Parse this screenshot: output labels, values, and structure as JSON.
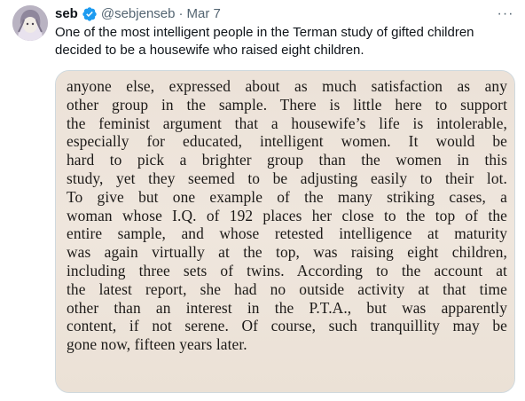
{
  "tweet": {
    "author": {
      "display_name": "seb",
      "handle": "@sebjenseb",
      "separator": "·",
      "date": "Mar 7",
      "verified_icon": "verified-badge-icon",
      "verified_color": "#1d9bf0"
    },
    "more_icon": "more-options-icon",
    "more_glyph": "···",
    "text": "One of the most intelligent people in the Terman study of gifted children decided to be a housewife who raised eight children.",
    "media": {
      "lines": [
        "anyone else, expressed about as much satisfaction as any",
        "other group in the sample. There is little here to support",
        "the feminist argument that a housewife’s life is intolerable,",
        "especially for educated, intelligent women. It would be",
        "hard to pick a brighter group than the women in this",
        "study, yet they seemed to be adjusting easily to their lot.",
        "To give but one example of the many striking cases, a",
        "woman whose I.Q. of 192 places her close to the top of the",
        "entire sample, and whose retested intelligence at maturity",
        "was again virtually at the top, was raising eight children,",
        "including three sets of twins. According to the account at",
        "the latest report, she had no outside activity at that time",
        "other than an interest in the P.T.A., but was apparently",
        "content, if not serene. Of course, such tranquillity may be",
        "gone now, fifteen years later."
      ]
    }
  }
}
